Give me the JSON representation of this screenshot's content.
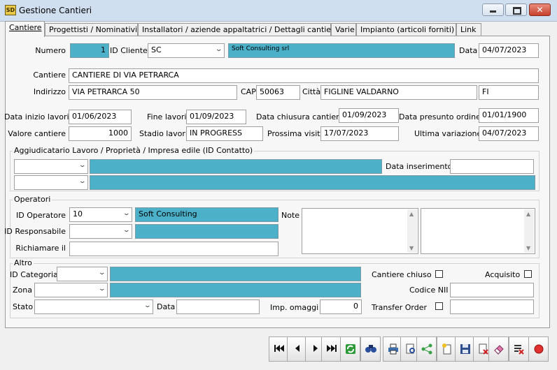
{
  "window": {
    "title": "Gestione Cantieri",
    "app_icon_text": "SD"
  },
  "tabs": [
    {
      "label": "Cantiere"
    },
    {
      "label": "Progettisti / Nominativi"
    },
    {
      "label": "Installatori / aziende appaltatrici / Dettagli cantiere"
    },
    {
      "label": "Varie"
    },
    {
      "label": "Impianto (articoli forniti)"
    },
    {
      "label": "Link"
    }
  ],
  "header": {
    "numero_label": "Numero",
    "numero_value": "1",
    "id_cliente_label": "ID Cliente",
    "id_cliente_value": "SC",
    "cliente_name": "Soft Consulting srl",
    "data_label": "Data",
    "data_value": "04/07/2023"
  },
  "site": {
    "cantiere_label": "Cantiere",
    "cantiere_value": "CANTIERE DI VIA PETRARCA",
    "indirizzo_label": "Indirizzo",
    "indirizzo_value": "VIA PETRARCA 50",
    "cap_label": "CAP",
    "cap_value": "50063",
    "citta_label": "Città",
    "citta_value": "FIGLINE VALDARNO",
    "provincia_value": "FI"
  },
  "dates": {
    "inizio_label": "Data inizio lavori",
    "inizio_value": "01/06/2023",
    "fine_label": "Fine lavori",
    "fine_value": "01/09/2023",
    "chiusura_label": "Data chiusura cantiere",
    "chiusura_value": "01/09/2023",
    "presunto_label": "Data presunto ordine",
    "presunto_value": "01/01/1900",
    "valore_label": "Valore cantiere",
    "valore_value": "1000",
    "stadio_label": "Stadio lavori",
    "stadio_value": "IN PROGRESS",
    "visita_label": "Prossima visita",
    "visita_value": "17/07/2023",
    "variazione_label": "Ultima variazione",
    "variazione_value": "04/07/2023"
  },
  "aggiudicatario": {
    "title": "Aggiudicatario Lavoro / Proprietà / Impresa edile (ID Contatto)",
    "data_inserimento_label": "Data inserimento"
  },
  "operatori": {
    "title": "Operatori",
    "id_operatore_label": "ID Operatore",
    "id_operatore_value": "10",
    "operatore_name": "Soft Consulting",
    "id_responsabile_label": "ID Responsabile",
    "richiamare_label": "Richiamare il",
    "note_label": "Note"
  },
  "altro": {
    "title": "Altro",
    "categoria_label": "ID Categoria",
    "zona_label": "Zona",
    "stato_label": "Stato",
    "data_label": "Data",
    "omaggi_label": "Imp. omaggi",
    "omaggi_value": "0",
    "chiuso_label": "Cantiere chiuso",
    "acquisito_label": "Acquisito",
    "codice_nii_label": "Codice NII",
    "transfer_label": "Transfer Order"
  },
  "toolbar_icons": [
    "first-record-icon",
    "prev-record-icon",
    "next-record-icon",
    "last-record-icon",
    "refresh-icon",
    "find-icon",
    "print-icon",
    "print-preview-icon",
    "share-icon",
    "new-record-icon",
    "save-icon",
    "delete-icon",
    "eraser-icon",
    "cancel-icon",
    "stop-icon"
  ],
  "colors": {
    "accent_teal": "#4bb0c8",
    "close_red": "#c7412d",
    "stop_red": "#e03030"
  }
}
